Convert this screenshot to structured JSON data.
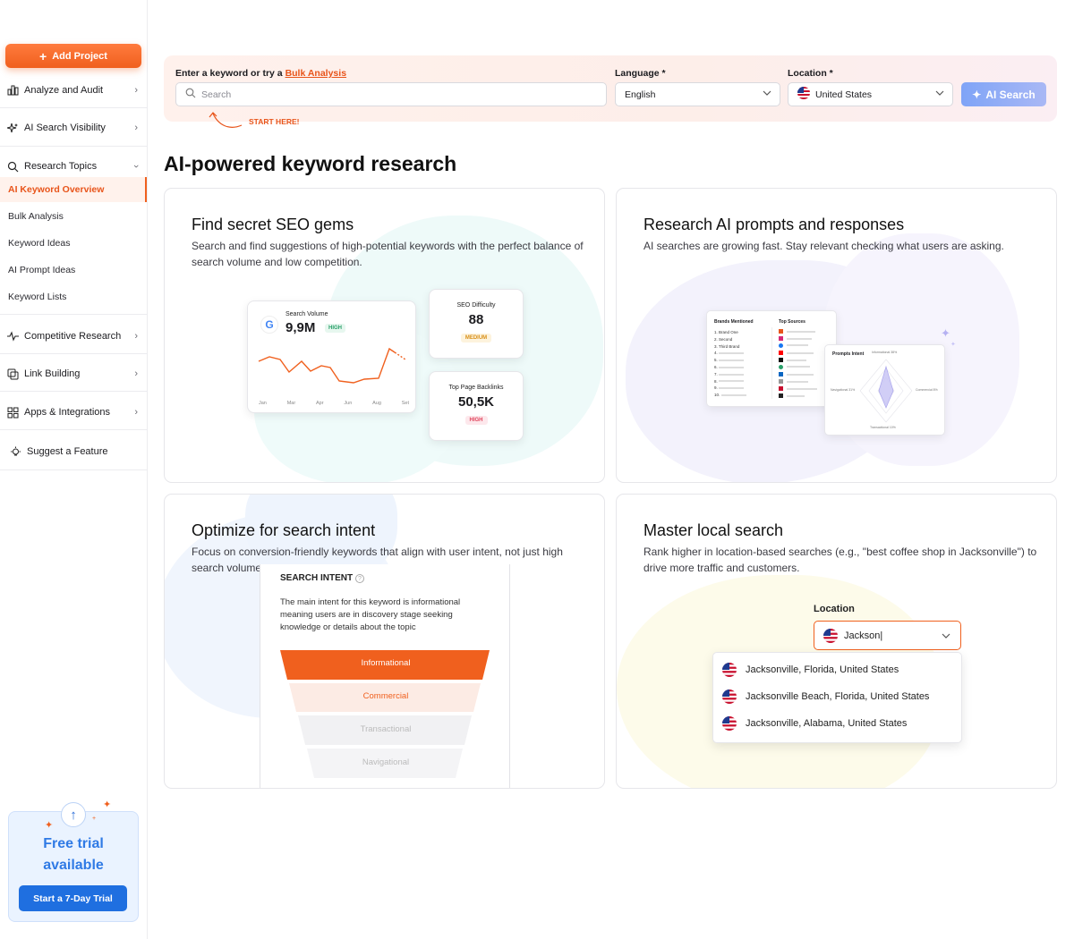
{
  "sidebar": {
    "add_project": "Add Project",
    "items": [
      {
        "label": "Analyze and Audit"
      },
      {
        "label": "AI Search Visibility"
      },
      {
        "label": "Research Topics"
      },
      {
        "label": "Competitive Research"
      },
      {
        "label": "Link Building"
      },
      {
        "label": "Apps & Integrations"
      },
      {
        "label": "Suggest a Feature"
      }
    ],
    "sub_items": [
      "AI Keyword Overview",
      "Bulk Analysis",
      "Keyword Ideas",
      "AI Prompt Ideas",
      "Keyword Lists"
    ],
    "trial": {
      "title_line1": "Free trial",
      "title_line2": "available",
      "button": "Start a 7-Day Trial"
    }
  },
  "search": {
    "label_prefix": "Enter a keyword or try a",
    "label_link": "Bulk Analysis",
    "placeholder": "Search",
    "language_label": "Language *",
    "language_value": "English",
    "location_label": "Location *",
    "location_value": "United States",
    "button": "AI Search",
    "hint": "START HERE!"
  },
  "page_title": "AI-powered keyword research",
  "cards": {
    "seo": {
      "title": "Find secret SEO gems",
      "desc": "Search and find suggestions of high-potential keywords with the perfect balance of search volume and low competition.",
      "sv_label": "Search Volume",
      "sv_value": "9,9M",
      "sv_badge": "HIGH",
      "months": [
        "Jan",
        "Mar",
        "Apr",
        "Jun",
        "Aug",
        "Set"
      ],
      "kd_label": "SEO Difficulty",
      "kd_value": "88",
      "kd_badge": "MEDIUM",
      "bl_label": "Top Page Backlinks",
      "bl_value": "50,5K",
      "bl_badge": "HIGH"
    },
    "prompts": {
      "title": "Research AI prompts and responses",
      "desc": "AI searches are growing fast. Stay relevant checking what users are asking.",
      "brands_label": "Brands Mentioned",
      "sources_label": "Top Sources",
      "brands": [
        "1. Brand One",
        "2. Second",
        "3. Third Brand"
      ],
      "numbers": [
        "4.",
        "5.",
        "6.",
        "7.",
        "8.",
        "9.",
        "10."
      ],
      "intent_label": "Prompts Intent",
      "axis_top": "Informational 38%",
      "axis_left": "Navigational 31%",
      "axis_right": "Commercial 8%",
      "axis_bottom": "Transactional 10%"
    },
    "intent": {
      "title": "Optimize for search intent",
      "desc": "Focus on conversion-friendly keywords that align with user intent, not just high search volume.",
      "box_title": "SEARCH INTENT",
      "box_text": "The main intent for this keyword is informational meaning users are in discovery stage seeking knowledge or details about the topic",
      "levels": [
        "Informational",
        "Commercial",
        "Transactional",
        "Navigational"
      ]
    },
    "local": {
      "title": "Master local search",
      "desc": "Rank higher in location-based searches (e.g., \"best coffee shop in Jacksonville\") to drive more traffic and customers.",
      "loc_label": "Location",
      "loc_value": "Jackson|",
      "options": [
        "Jacksonville, Florida, United States",
        "Jacksonville Beach, Florida, United States",
        "Jacksonville, Alabama, United States"
      ]
    }
  },
  "colors": {
    "accent": "#f0601e",
    "blue": "#1f6fe0"
  }
}
